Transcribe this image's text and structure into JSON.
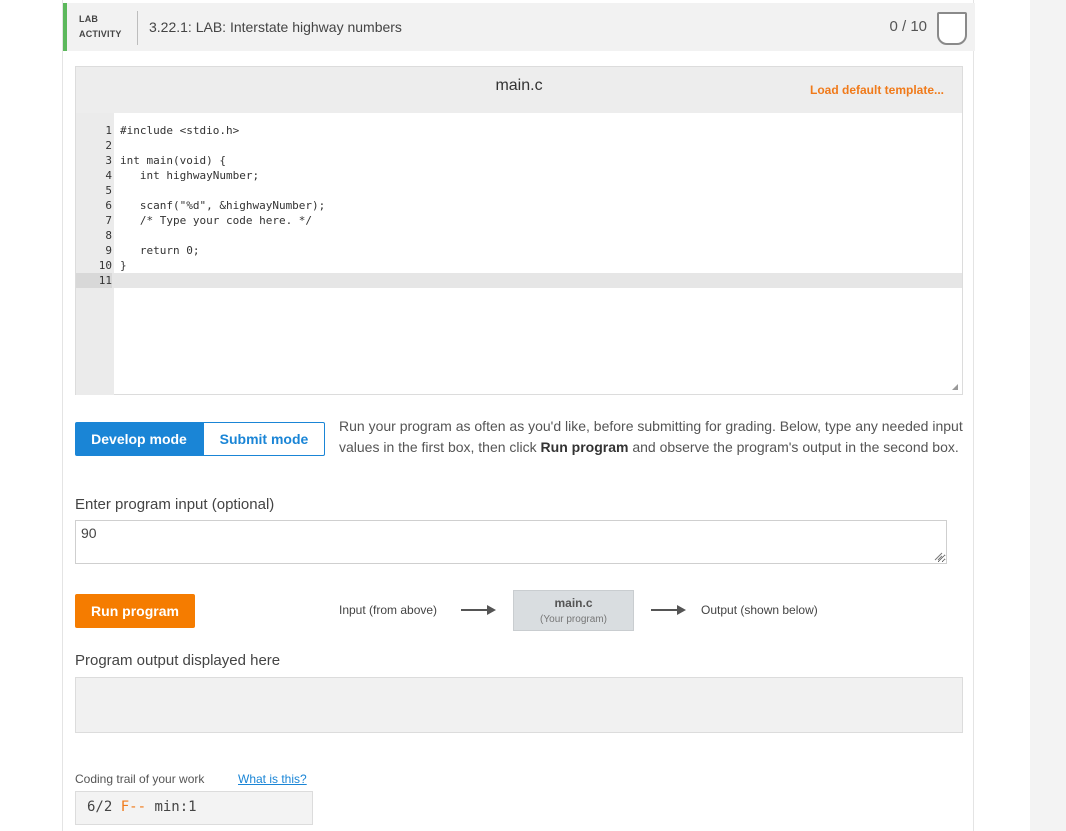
{
  "header": {
    "lab_line1": "LAB",
    "lab_line2": "ACTIVITY",
    "title": "3.22.1: LAB: Interstate highway numbers",
    "score": "0 / 10",
    "accent_color": "#5cb85c"
  },
  "editor": {
    "file_name": "main.c",
    "load_default": "Load default template...",
    "lines": [
      {
        "n": "1",
        "code": "#include <stdio.h>"
      },
      {
        "n": "2",
        "code": ""
      },
      {
        "n": "3",
        "code": "int main(void) {"
      },
      {
        "n": "4",
        "code": "   int highwayNumber;"
      },
      {
        "n": "5",
        "code": ""
      },
      {
        "n": "6",
        "code": "   scanf(\"%d\", &highwayNumber);"
      },
      {
        "n": "7",
        "code": "   /* Type your code here. */"
      },
      {
        "n": "8",
        "code": ""
      },
      {
        "n": "9",
        "code": "   return 0;"
      },
      {
        "n": "10",
        "code": "}"
      },
      {
        "n": "11",
        "code": ""
      }
    ],
    "active_line": "11"
  },
  "modes": {
    "develop": "Develop mode",
    "submit": "Submit mode",
    "active_color": "#1a85d6"
  },
  "instructions": {
    "part1": "Run your program as often as you'd like, before submitting for grading. Below, type any needed input values in the first box, then click ",
    "bold": "Run program",
    "part2": " and observe the program's output in the second box."
  },
  "input": {
    "label": "Enter program input (optional)",
    "value": "90"
  },
  "run": {
    "button": "Run program",
    "button_color": "#f57c00",
    "flow_input": "Input (from above)",
    "flow_file": "main.c",
    "flow_file_sub": "(Your program)",
    "flow_output": "Output (shown below)"
  },
  "output": {
    "label": "Program output displayed here",
    "value": ""
  },
  "trail": {
    "label": "Coding trail of your work",
    "link": "What is this?",
    "prefix": "6/2 ",
    "flag": "F--",
    "suffix": " min:1"
  }
}
